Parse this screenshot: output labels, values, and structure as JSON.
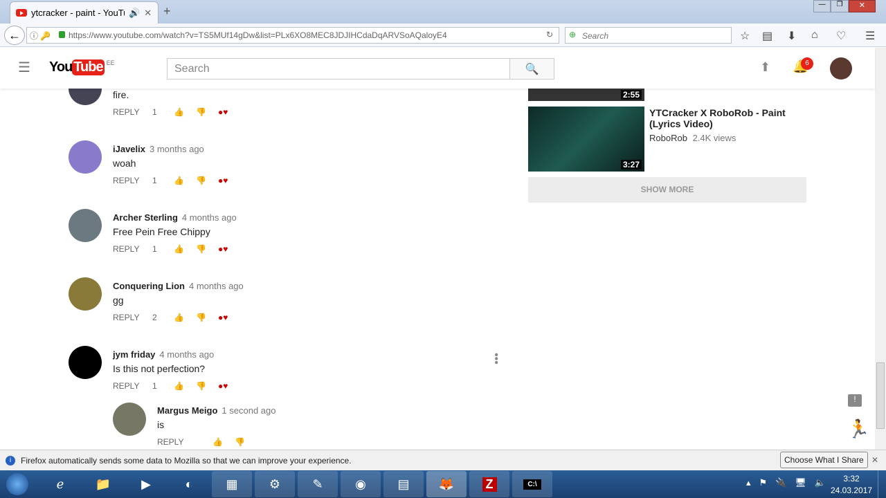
{
  "browser": {
    "tab_title": "ytcracker - paint - YouTube",
    "url_domain": "youtube.com",
    "url": "https://www.youtube.com/watch?v=TS5MUf14gDw&list=PLx6XO8MEC8JDJIHCdaDqARVSoAQaloyE4",
    "search_placeholder": "Search"
  },
  "youtube": {
    "logo": "YouTube",
    "region": "EE",
    "search_placeholder": "Search",
    "notification_count": "6"
  },
  "comments": [
    {
      "name": "",
      "time": "",
      "text": "fire.",
      "likes": "1"
    },
    {
      "name": "iJavelix",
      "time": "3 months ago",
      "text": "woah",
      "likes": "1"
    },
    {
      "name": "Archer Sterling",
      "time": "4 months ago",
      "text": "Free Pein Free Chippy",
      "likes": "1"
    },
    {
      "name": "Conquering Lion",
      "time": "4 months ago",
      "text": "gg",
      "likes": "2"
    },
    {
      "name": "jym friday",
      "time": "4 months ago",
      "text": "Is this not perfection?",
      "likes": "1"
    }
  ],
  "reply_comment": {
    "name": "Margus Meigo",
    "time": "1 second ago",
    "text": "is"
  },
  "reply_label": "REPLY",
  "sidebar": {
    "videos": [
      {
        "duration": "2:55"
      },
      {
        "title": "YTCracker X RoboRob - Paint (Lyrics Video)",
        "channel": "RoboRob",
        "views": "2.4K views",
        "duration": "3:27"
      }
    ],
    "show_more": "SHOW MORE"
  },
  "notification": {
    "text": "Firefox automatically sends some data to Mozilla so that we can improve your experience.",
    "button": "Choose What I Share"
  },
  "clock": {
    "time": "3:32",
    "date": "24.03.2017"
  }
}
